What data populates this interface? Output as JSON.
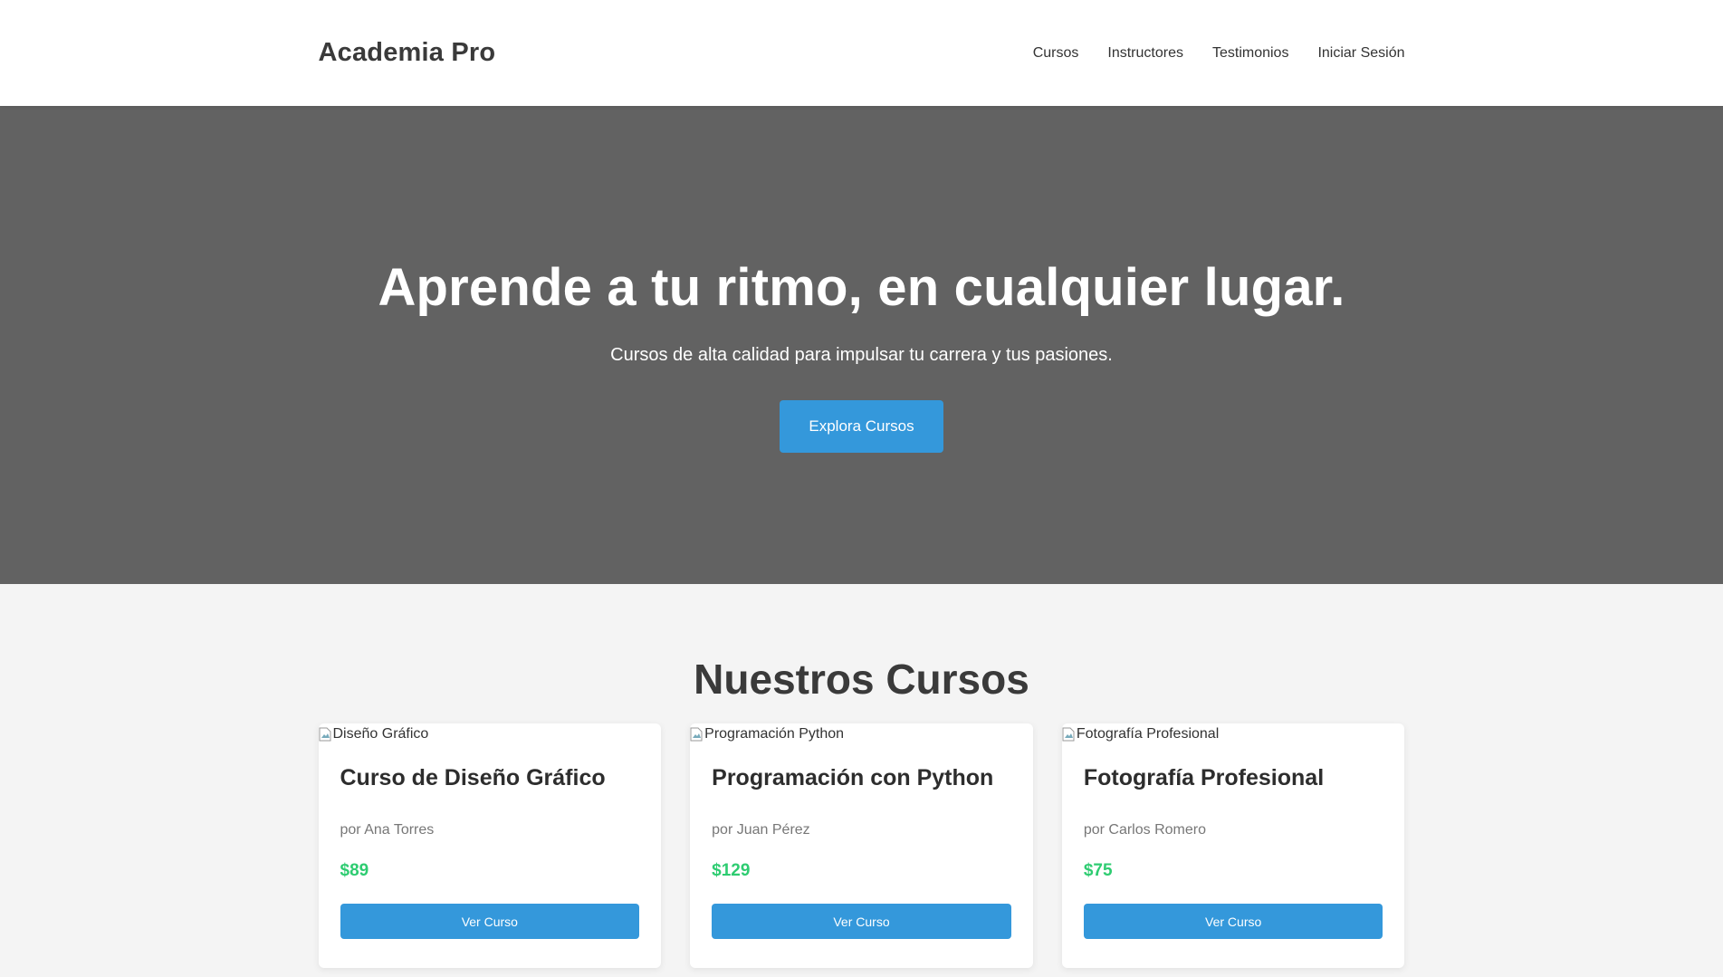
{
  "colors": {
    "accent": "#3498db",
    "price": "#2ecc71",
    "hero_bg": "#626262",
    "page_bg": "#f4f4f4"
  },
  "header": {
    "logo": "Academia Pro",
    "nav": [
      {
        "label": "Cursos"
      },
      {
        "label": "Instructores"
      },
      {
        "label": "Testimonios"
      },
      {
        "label": "Iniciar Sesión"
      }
    ]
  },
  "hero": {
    "title": "Aprende a tu ritmo, en cualquier lugar.",
    "subtitle": "Cursos de alta calidad para impulsar tu carrera y tus pasiones.",
    "cta_label": "Explora Cursos"
  },
  "courses": {
    "section_title": "Nuestros Cursos",
    "items": [
      {
        "image_alt": "Diseño Gráfico",
        "title": "Curso de Diseño Gráfico",
        "author": "por Ana Torres",
        "price": "$89",
        "button_label": "Ver Curso"
      },
      {
        "image_alt": "Programación Python",
        "title": "Programación con Python",
        "author": "por Juan Pérez",
        "price": "$129",
        "button_label": "Ver Curso"
      },
      {
        "image_alt": "Fotografía Profesional",
        "title": "Fotografía Profesional",
        "author": "por Carlos Romero",
        "price": "$75",
        "button_label": "Ver Curso"
      }
    ]
  }
}
